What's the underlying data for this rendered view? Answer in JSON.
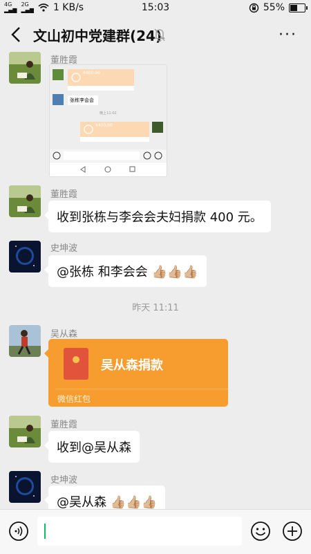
{
  "status_bar": {
    "network_left": "4G",
    "network_right": "2G",
    "speed": "1 KB/s",
    "time": "15:03",
    "battery_percent": "55%",
    "battery_level": 0.55
  },
  "header": {
    "title": "文山初中党建群(24)",
    "more": "···"
  },
  "messages": [
    {
      "sender": "董胜霞"
    },
    {
      "sender": "董胜霞",
      "text": "收到张栋与李会会夫妇捐款 400 元。"
    },
    {
      "sender": "史坤波",
      "text": "@张栋  和李会会"
    },
    {
      "sender": "吴从森"
    },
    {
      "sender": "董胜霞",
      "text": "收到@吴从森"
    },
    {
      "sender": "史坤波",
      "text": "@吴从森 "
    }
  ],
  "embedded_screenshot": {
    "amount": "¥400.00",
    "name_label": "张栋李会会",
    "time": "晚上11:02"
  },
  "timestamp": "昨天 11:11",
  "red_packet": {
    "title": "吴从森捐款",
    "footer": "微信红包"
  },
  "emoji_name": "thumbs-up",
  "colors": {
    "background": "#ededed",
    "red_packet": "#f79c2e",
    "input_cursor": "#07c160"
  }
}
